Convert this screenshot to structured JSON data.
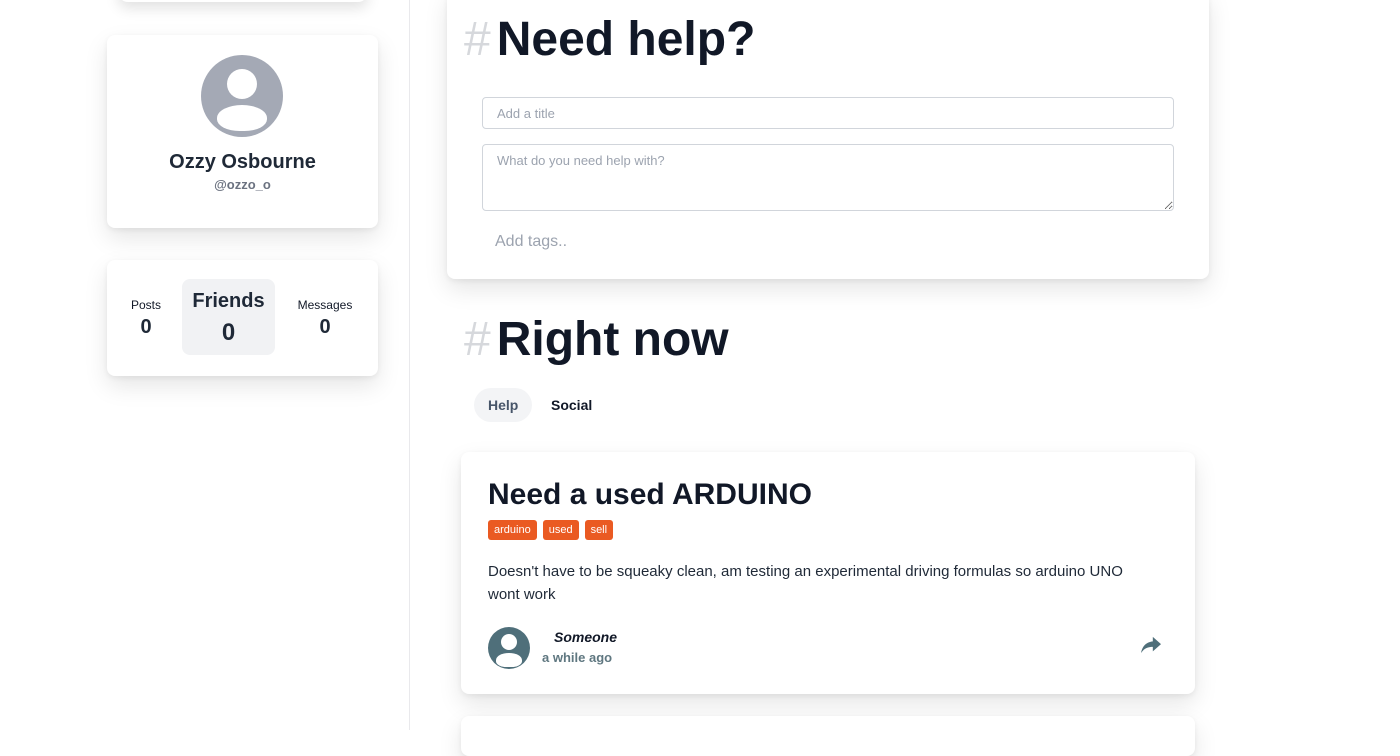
{
  "profile": {
    "name": "Ozzy Osbourne",
    "handle": "@ozzo_o"
  },
  "stats": {
    "posts_label": "Posts",
    "posts_value": "0",
    "friends_label": "Friends",
    "friends_value": "0",
    "messages_label": "Messages",
    "messages_value": "0"
  },
  "help_form": {
    "heading_hash": "#",
    "heading": "Need help?",
    "title_placeholder": "Add a title",
    "body_placeholder": "What do you need help with?",
    "tags_placeholder": "Add tags.."
  },
  "feed": {
    "heading_hash": "#",
    "heading": "Right now",
    "tabs": [
      {
        "label": "Help",
        "active": true
      },
      {
        "label": "Social",
        "active": false
      }
    ],
    "posts": [
      {
        "title": "Need a used ARDUINO",
        "tags": [
          "arduino",
          "used",
          "sell"
        ],
        "body": "Doesn't have to be squeaky clean, am testing an experimental driving formulas so arduino UNO wont work",
        "author": "Someone",
        "time": "a while ago"
      }
    ]
  },
  "colors": {
    "tag_bg": "#ea5a22",
    "avatar_gray": "#a4a9b5",
    "post_avatar": "#4f6f7a",
    "muted_text": "#6b7280"
  },
  "icons": {
    "share": "share-arrow-icon",
    "avatar": "user-avatar-icon"
  }
}
